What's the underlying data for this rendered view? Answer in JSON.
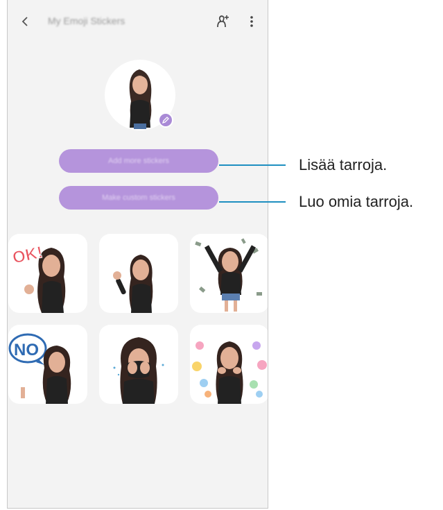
{
  "header": {
    "title": "My Emoji Stickers",
    "back_icon": "chevron-left-icon",
    "add_icon": "add-person-icon",
    "more_icon": "more-vertical-icon"
  },
  "profile": {
    "edit_icon": "pencil-icon"
  },
  "buttons": {
    "add_more": "Add more stickers",
    "make_custom": "Make custom stickers"
  },
  "stickers": [
    {
      "text": "OK!"
    },
    {
      "text": ""
    },
    {
      "text": ""
    },
    {
      "text": "NO"
    },
    {
      "text": ""
    },
    {
      "text": ""
    }
  ],
  "callouts": {
    "add_more": "Lisää tarroja.",
    "make_custom": "Luo omia tarroja."
  },
  "colors": {
    "accent": "#b594dc",
    "callout_line": "#1e8fc0"
  }
}
